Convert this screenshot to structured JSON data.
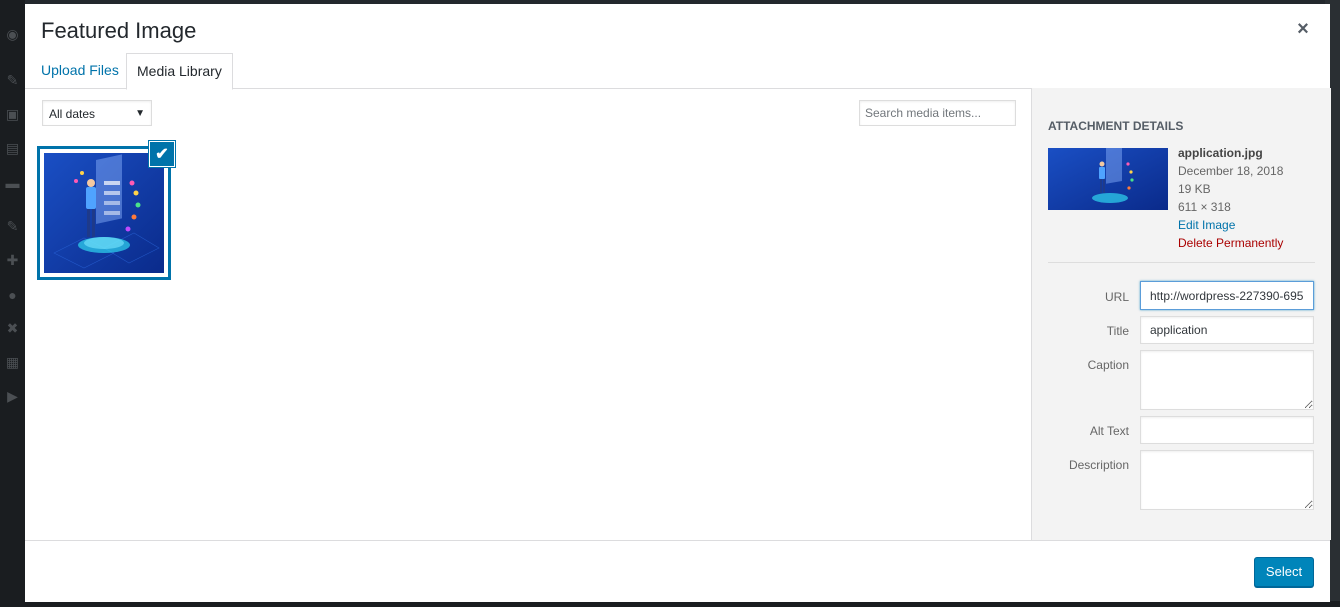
{
  "modal": {
    "title": "Featured Image",
    "close_icon": "×"
  },
  "tabs": {
    "upload": "Upload Files",
    "library": "Media Library"
  },
  "toolbar": {
    "date_filter": "All dates",
    "search_placeholder": "Search media items..."
  },
  "attachment": {
    "selected": true,
    "check_glyph": "✔"
  },
  "details": {
    "heading": "ATTACHMENT DETAILS",
    "filename": "application.jpg",
    "date": "December 18, 2018",
    "size": "19 KB",
    "dimensions": "611 × 318",
    "edit_link": "Edit Image",
    "delete_link": "Delete Permanently"
  },
  "fields": {
    "url_label": "URL",
    "url_value": "http://wordpress-227390-695",
    "title_label": "Title",
    "title_value": "application",
    "caption_label": "Caption",
    "alt_label": "Alt Text",
    "description_label": "Description"
  },
  "footer": {
    "select_label": "Select"
  },
  "colors": {
    "accent": "#0073aa",
    "button": "#0085ba",
    "delete": "#aa0000"
  }
}
